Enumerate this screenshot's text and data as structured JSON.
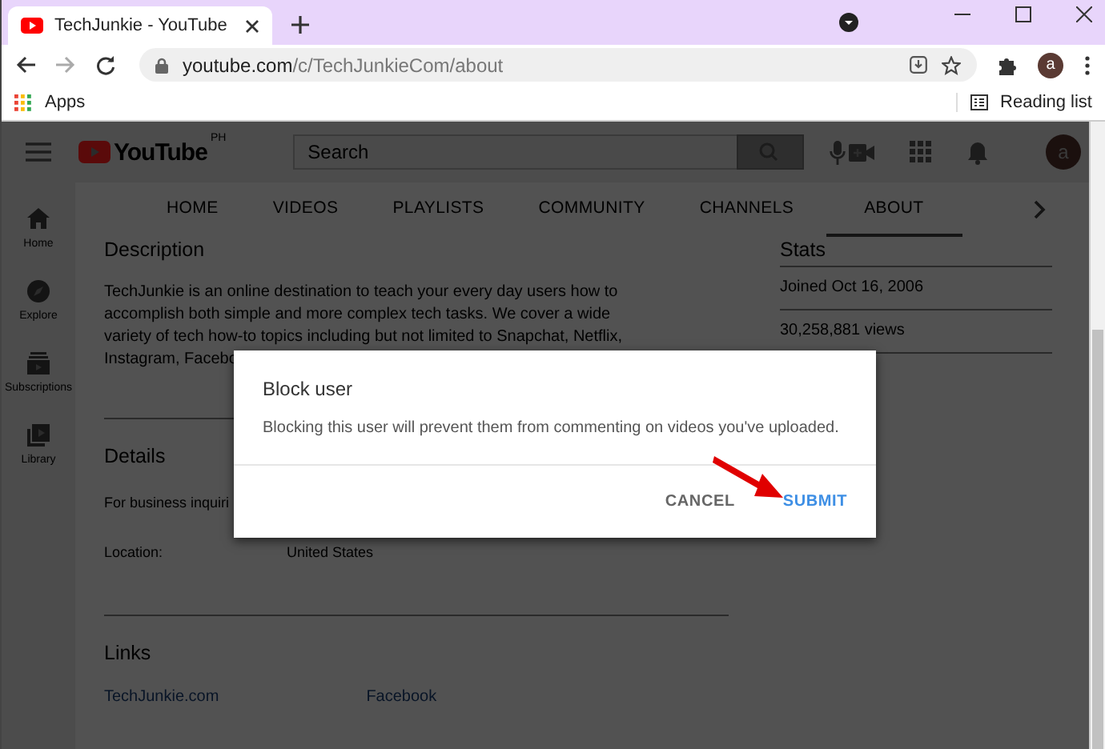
{
  "browser": {
    "tab": {
      "title": "TechJunkie - YouTube"
    },
    "address": {
      "host": "youtube.com",
      "path": "/c/TechJunkieCom/about"
    },
    "profile_initial": "a",
    "bookmarks": [
      {
        "label": "Apps"
      }
    ],
    "reading_list": "Reading list"
  },
  "youtube": {
    "logo": "YouTube",
    "region": "PH",
    "search_placeholder": "Search",
    "avatar": "a",
    "sidebar": [
      {
        "label": "Home",
        "kind": "home"
      },
      {
        "label": "Explore",
        "kind": "explore"
      },
      {
        "label": "Subscriptions",
        "kind": "subscriptions"
      },
      {
        "label": "Library",
        "kind": "library"
      }
    ],
    "tabs": [
      {
        "label": "HOME",
        "selected": false
      },
      {
        "label": "VIDEOS",
        "selected": false
      },
      {
        "label": "PLAYLISTS",
        "selected": false
      },
      {
        "label": "COMMUNITY",
        "selected": false
      },
      {
        "label": "CHANNELS",
        "selected": false
      },
      {
        "label": "ABOUT",
        "selected": true
      }
    ],
    "description": {
      "heading": "Description",
      "lines": [
        "TechJunkie is an online destination to teach your every day users how to",
        "accomplish both simple and more complex tech tasks.  We cover a wide",
        "variety of tech how-to  topics including but not limited to Snapchat, Netflix,",
        "Instagram, Facebo"
      ]
    },
    "details": {
      "heading": "Details",
      "rows": [
        {
          "label": "For business inquiri"
        },
        {
          "label": "Location:",
          "value": "United States"
        }
      ]
    },
    "links": {
      "heading": "Links",
      "items": [
        "TechJunkie.com",
        "Facebook"
      ]
    },
    "stats": {
      "heading": "Stats",
      "items": [
        "Joined Oct 16, 2006",
        "30,258,881 views"
      ]
    }
  },
  "dialog": {
    "title": "Block user",
    "message": "Blocking this user will prevent them from commenting on videos you've uploaded.",
    "buttons": [
      {
        "label": "CANCEL",
        "kind": "secondary"
      },
      {
        "label": "SUBMIT",
        "kind": "primary"
      }
    ]
  }
}
